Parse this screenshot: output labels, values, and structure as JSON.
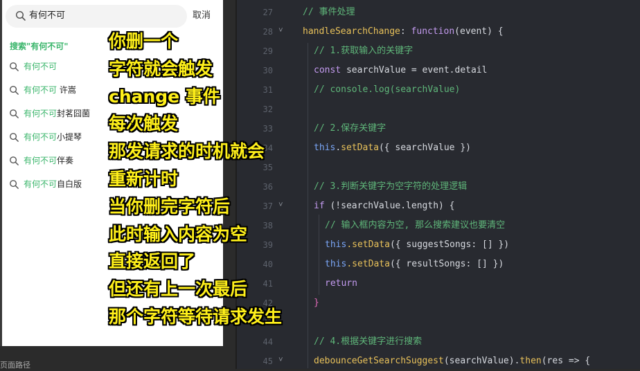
{
  "simulator": {
    "search_value": "有何不可",
    "cancel_label": "取消",
    "search_title": "搜索\"有何不可\"",
    "suggestions": [
      {
        "highlight": "有何不可",
        "rest": ""
      },
      {
        "highlight": "有何不可",
        "rest": " 许嵩"
      },
      {
        "highlight": "有何不可",
        "rest": "封茗囧菌"
      },
      {
        "highlight": "有何不可",
        "rest": "小提琴"
      },
      {
        "highlight": "有何不可",
        "rest": "伴奏"
      },
      {
        "highlight": "有何不可",
        "rest": "自白版"
      }
    ]
  },
  "bottom_bar": {
    "text": "页面路径"
  },
  "editor": {
    "lines": [
      {
        "num": "27",
        "fold": ""
      },
      {
        "num": "28",
        "fold": "˅"
      },
      {
        "num": "29",
        "fold": ""
      },
      {
        "num": "30",
        "fold": ""
      },
      {
        "num": "31",
        "fold": ""
      },
      {
        "num": "32",
        "fold": ""
      },
      {
        "num": "33",
        "fold": ""
      },
      {
        "num": "34",
        "fold": ""
      },
      {
        "num": "35",
        "fold": ""
      },
      {
        "num": "36",
        "fold": ""
      },
      {
        "num": "37",
        "fold": "˅"
      },
      {
        "num": "38",
        "fold": ""
      },
      {
        "num": "39",
        "fold": ""
      },
      {
        "num": "40",
        "fold": ""
      },
      {
        "num": "41",
        "fold": ""
      },
      {
        "num": "42",
        "fold": ""
      },
      {
        "num": "43",
        "fold": ""
      },
      {
        "num": "44",
        "fold": ""
      },
      {
        "num": "45",
        "fold": "˅"
      }
    ],
    "code": {
      "l27": "// 事件处理",
      "l28_fn": "handleSearchChange",
      "l28_colon": ": ",
      "l28_kw": "function",
      "l28_paren": "(event) {",
      "l29": "// 1.获取输入的关键字",
      "l30_kw": "const",
      "l30_rest": " searchValue = event.detail",
      "l31": "// console.log(searchValue)",
      "l33": "// 2.保存关键字",
      "l34_this": "this",
      "l34_dot": ".",
      "l34_fn": "setData",
      "l34_rest": "({ searchValue })",
      "l36": "// 3.判断关键字为空字符的处理逻辑",
      "l37_kw": "if",
      "l37_rest": " (!searchValue.length) {",
      "l38": "// 输入框内容为空, 那么搜索建议也要清空",
      "l39_this": "this",
      "l39_fn": ".setData",
      "l39_rest": "({ suggestSongs: [] })",
      "l40_this": "this",
      "l40_fn": ".setData",
      "l40_rest": "({ resultSongs: [] })",
      "l41_kw": "return",
      "l42": "}",
      "l44": "// 4.根据关键字进行搜索",
      "l45_fn": "debounceGetSearchSuggest",
      "l45_mid": "(searchValue).",
      "l45_then": "then",
      "l45_rest": "(res => {"
    }
  },
  "annotation": {
    "lines": [
      "你删一个",
      "字符就会触发",
      "change 事件",
      "每次触发",
      "那发请求的时机就会",
      "重新计时",
      "当你删完字符后",
      "此时输入内容为空",
      "直接返回了",
      "但还有上一次最后",
      "那个字符等待请求发生"
    ]
  },
  "colors": {
    "accent_green": "#39b56a",
    "annotation_yellow": "#fff01a",
    "editor_bg": "#282a30",
    "comment": "#5fb77a",
    "function": "#e8c15a",
    "keyword": "#c49bf0"
  }
}
